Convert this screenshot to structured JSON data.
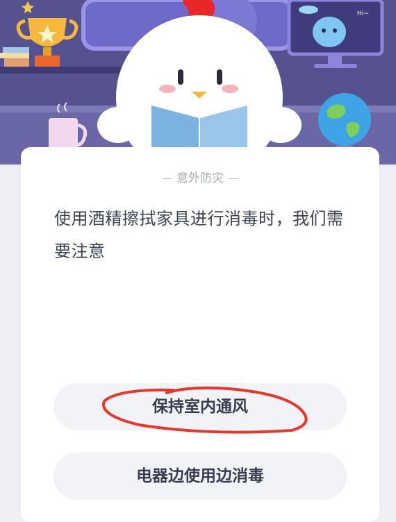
{
  "quiz": {
    "category": "意外防灾",
    "question": "使用酒精擦拭家具进行消毒时，我们需要注意",
    "options": [
      {
        "label": "保持室内通风",
        "marked": true
      },
      {
        "label": "电器边使用边消毒",
        "marked": false
      }
    ]
  },
  "illustration": {
    "speech_text": "Hi~",
    "icons": [
      "trophy-icon",
      "chick-mascot-icon",
      "alien-on-monitor-icon",
      "globe-icon",
      "mug-icon",
      "books-icon"
    ]
  },
  "colors": {
    "marker_circle": "#e8372a",
    "chick_comb": "#e8272a",
    "book": "#7bb2e0"
  }
}
